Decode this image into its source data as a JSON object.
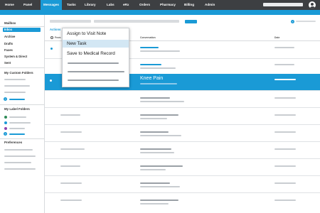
{
  "nav": {
    "items": [
      "Home",
      "Panel",
      "Messages",
      "Tasks",
      "Library",
      "Labs",
      "eRx",
      "Orders",
      "Pharmacy",
      "Billing",
      "Admin"
    ],
    "active": "Messages",
    "accent": "#1a9ad6",
    "bar_color": "#3d3f42",
    "avatar_icon": "user-avatar-icon"
  },
  "sidebar": {
    "title": "Mailbox",
    "items": [
      "Inbox",
      "Archive",
      "Drafts",
      "Faxes",
      "System & Direct",
      "Sent"
    ],
    "selected": "Inbox",
    "custom_folders_title": "My Custom Folders",
    "label_folders_title": "My Label Folders",
    "label_colors": [
      "#2e8b57",
      "#1a9ad6",
      "#8e44ad"
    ],
    "preferences_title": "Preferences"
  },
  "toolbar": {
    "actions_label": "Actions"
  },
  "table": {
    "headers": [
      "From",
      "Conversation",
      "Date"
    ],
    "selected_row_title": "Knee Pain"
  },
  "context_menu": {
    "items": [
      "Assign to Visit Note",
      "New Task",
      "Save to Medical Record"
    ],
    "highlighted": "New Task"
  }
}
